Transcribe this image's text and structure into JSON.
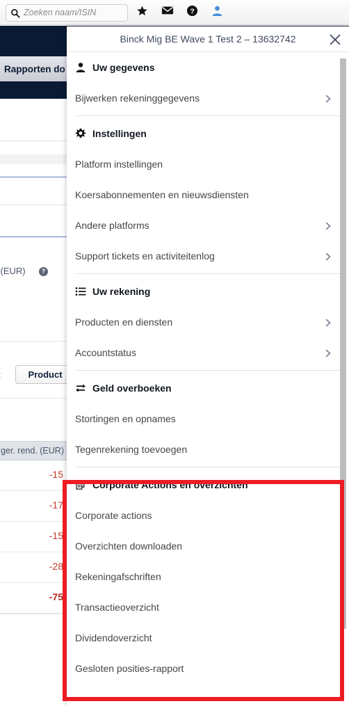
{
  "topbar": {
    "search": {
      "placeholder": "Zoeken naam/ISIN",
      "value": "",
      "icon": "search-icon"
    },
    "icons": [
      {
        "name": "star-icon",
        "label": "Favorieten"
      },
      {
        "name": "mail-icon",
        "label": "Berichten"
      },
      {
        "name": "help-icon",
        "label": "Help"
      },
      {
        "name": "user-icon",
        "label": "Account"
      }
    ]
  },
  "background": {
    "nav_tab_label": "Rapporten do",
    "column_label": "at (EUR)",
    "column_help_badge": "?",
    "sort_label": "g:",
    "sort_value": "Product",
    "table": {
      "header": "ger. rend. (EUR)",
      "rows": [
        {
          "value": "-15"
        },
        {
          "value": "-17"
        },
        {
          "value": "-15"
        },
        {
          "value": "-28"
        },
        {
          "value": "-75",
          "total": true
        }
      ]
    }
  },
  "panel": {
    "title": "Binck Mig BE Wave 1 Test 2 – 13632742",
    "close_icon": "close-icon",
    "sections": [
      {
        "id": "uw-gegevens",
        "icon": "person-icon",
        "title": "Uw gegevens",
        "items": [
          {
            "label": "Bijwerken rekeninggegevens",
            "chevron": true
          }
        ]
      },
      {
        "id": "instellingen",
        "icon": "gear-icon",
        "title": "Instellingen",
        "items": [
          {
            "label": "Platform instellingen",
            "chevron": false
          },
          {
            "label": "Koersabonnementen en nieuwsdiensten",
            "chevron": false
          },
          {
            "label": "Andere platforms",
            "chevron": true
          },
          {
            "label": "Support tickets en activiteitenlog",
            "chevron": true
          }
        ]
      },
      {
        "id": "uw-rekening",
        "icon": "list-icon",
        "title": "Uw rekening",
        "items": [
          {
            "label": "Producten en diensten",
            "chevron": true
          },
          {
            "label": "Accountstatus",
            "chevron": true
          }
        ]
      },
      {
        "id": "geld-overboeken",
        "icon": "transfer-icon",
        "title": "Geld overboeken",
        "items": [
          {
            "label": "Stortingen en opnames",
            "chevron": false
          },
          {
            "label": "Tegenrekening toevoegen",
            "chevron": false
          }
        ]
      },
      {
        "id": "corporate-actions",
        "icon": "documents-icon",
        "title": "Corporate Actions en overzichten",
        "highlighted": true,
        "items": [
          {
            "label": "Corporate actions",
            "chevron": false
          },
          {
            "label": "Overzichten downloaden",
            "chevron": false
          },
          {
            "label": "Rekeningafschriften",
            "chevron": false
          },
          {
            "label": "Transactieoverzicht",
            "chevron": false
          },
          {
            "label": "Dividendoverzicht",
            "chevron": false
          },
          {
            "label": "Gesloten posities-rapport",
            "chevron": false
          }
        ]
      }
    ]
  },
  "annotation": {
    "highlight_color": "#ed1c24",
    "target_section": "Corporate Actions en overzichten"
  },
  "colors": {
    "nav_dark": "#0b1a33",
    "negative_value": "#c0392b",
    "accent_blue": "#4a90d9",
    "highlight_red": "#ed1c24"
  }
}
